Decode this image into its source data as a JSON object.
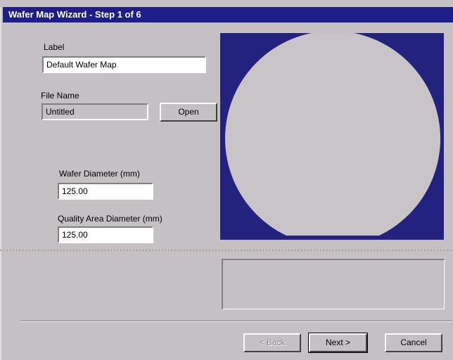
{
  "window": {
    "title": "Wafer Map Wizard  -  Step 1 of 6"
  },
  "form": {
    "label_caption": "Label",
    "label_value": "Default Wafer Map",
    "filename_caption": "File Name",
    "filename_value": "Untitled",
    "open_label": "Open",
    "wafer_diameter_caption": "Wafer Diameter (mm)",
    "wafer_diameter_value": "125.00",
    "quality_diameter_caption": "Quality Area Diameter (mm)",
    "quality_diameter_value": "125.00"
  },
  "preview": {
    "background": "#23237f",
    "wafer_color": "#c8c4c8"
  },
  "buttons": {
    "back": "< Back",
    "next": "Next >",
    "cancel": "Cancel"
  }
}
